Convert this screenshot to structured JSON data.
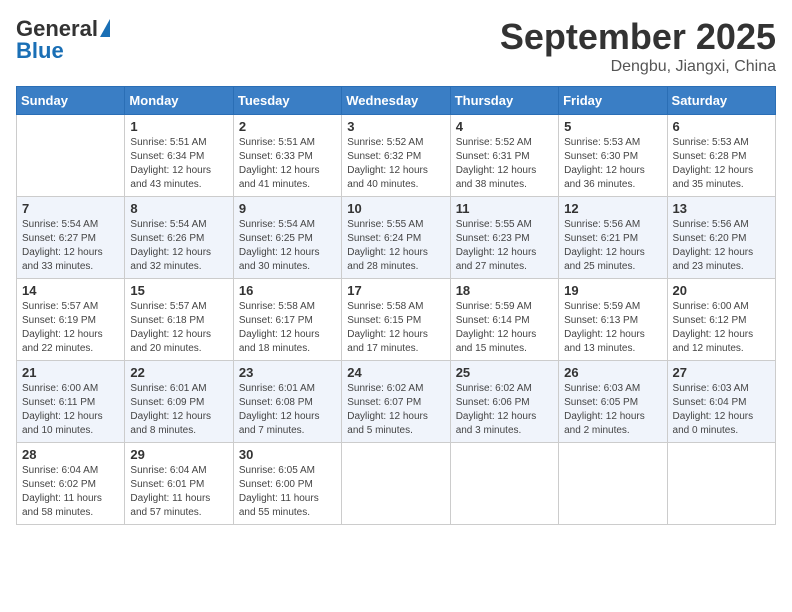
{
  "logo": {
    "general": "General",
    "blue": "Blue"
  },
  "header": {
    "month": "September 2025",
    "location": "Dengbu, Jiangxi, China"
  },
  "days_of_week": [
    "Sunday",
    "Monday",
    "Tuesday",
    "Wednesday",
    "Thursday",
    "Friday",
    "Saturday"
  ],
  "weeks": [
    [
      {
        "num": "",
        "info": ""
      },
      {
        "num": "1",
        "info": "Sunrise: 5:51 AM\nSunset: 6:34 PM\nDaylight: 12 hours\nand 43 minutes."
      },
      {
        "num": "2",
        "info": "Sunrise: 5:51 AM\nSunset: 6:33 PM\nDaylight: 12 hours\nand 41 minutes."
      },
      {
        "num": "3",
        "info": "Sunrise: 5:52 AM\nSunset: 6:32 PM\nDaylight: 12 hours\nand 40 minutes."
      },
      {
        "num": "4",
        "info": "Sunrise: 5:52 AM\nSunset: 6:31 PM\nDaylight: 12 hours\nand 38 minutes."
      },
      {
        "num": "5",
        "info": "Sunrise: 5:53 AM\nSunset: 6:30 PM\nDaylight: 12 hours\nand 36 minutes."
      },
      {
        "num": "6",
        "info": "Sunrise: 5:53 AM\nSunset: 6:28 PM\nDaylight: 12 hours\nand 35 minutes."
      }
    ],
    [
      {
        "num": "7",
        "info": "Sunrise: 5:54 AM\nSunset: 6:27 PM\nDaylight: 12 hours\nand 33 minutes."
      },
      {
        "num": "8",
        "info": "Sunrise: 5:54 AM\nSunset: 6:26 PM\nDaylight: 12 hours\nand 32 minutes."
      },
      {
        "num": "9",
        "info": "Sunrise: 5:54 AM\nSunset: 6:25 PM\nDaylight: 12 hours\nand 30 minutes."
      },
      {
        "num": "10",
        "info": "Sunrise: 5:55 AM\nSunset: 6:24 PM\nDaylight: 12 hours\nand 28 minutes."
      },
      {
        "num": "11",
        "info": "Sunrise: 5:55 AM\nSunset: 6:23 PM\nDaylight: 12 hours\nand 27 minutes."
      },
      {
        "num": "12",
        "info": "Sunrise: 5:56 AM\nSunset: 6:21 PM\nDaylight: 12 hours\nand 25 minutes."
      },
      {
        "num": "13",
        "info": "Sunrise: 5:56 AM\nSunset: 6:20 PM\nDaylight: 12 hours\nand 23 minutes."
      }
    ],
    [
      {
        "num": "14",
        "info": "Sunrise: 5:57 AM\nSunset: 6:19 PM\nDaylight: 12 hours\nand 22 minutes."
      },
      {
        "num": "15",
        "info": "Sunrise: 5:57 AM\nSunset: 6:18 PM\nDaylight: 12 hours\nand 20 minutes."
      },
      {
        "num": "16",
        "info": "Sunrise: 5:58 AM\nSunset: 6:17 PM\nDaylight: 12 hours\nand 18 minutes."
      },
      {
        "num": "17",
        "info": "Sunrise: 5:58 AM\nSunset: 6:15 PM\nDaylight: 12 hours\nand 17 minutes."
      },
      {
        "num": "18",
        "info": "Sunrise: 5:59 AM\nSunset: 6:14 PM\nDaylight: 12 hours\nand 15 minutes."
      },
      {
        "num": "19",
        "info": "Sunrise: 5:59 AM\nSunset: 6:13 PM\nDaylight: 12 hours\nand 13 minutes."
      },
      {
        "num": "20",
        "info": "Sunrise: 6:00 AM\nSunset: 6:12 PM\nDaylight: 12 hours\nand 12 minutes."
      }
    ],
    [
      {
        "num": "21",
        "info": "Sunrise: 6:00 AM\nSunset: 6:11 PM\nDaylight: 12 hours\nand 10 minutes."
      },
      {
        "num": "22",
        "info": "Sunrise: 6:01 AM\nSunset: 6:09 PM\nDaylight: 12 hours\nand 8 minutes."
      },
      {
        "num": "23",
        "info": "Sunrise: 6:01 AM\nSunset: 6:08 PM\nDaylight: 12 hours\nand 7 minutes."
      },
      {
        "num": "24",
        "info": "Sunrise: 6:02 AM\nSunset: 6:07 PM\nDaylight: 12 hours\nand 5 minutes."
      },
      {
        "num": "25",
        "info": "Sunrise: 6:02 AM\nSunset: 6:06 PM\nDaylight: 12 hours\nand 3 minutes."
      },
      {
        "num": "26",
        "info": "Sunrise: 6:03 AM\nSunset: 6:05 PM\nDaylight: 12 hours\nand 2 minutes."
      },
      {
        "num": "27",
        "info": "Sunrise: 6:03 AM\nSunset: 6:04 PM\nDaylight: 12 hours\nand 0 minutes."
      }
    ],
    [
      {
        "num": "28",
        "info": "Sunrise: 6:04 AM\nSunset: 6:02 PM\nDaylight: 11 hours\nand 58 minutes."
      },
      {
        "num": "29",
        "info": "Sunrise: 6:04 AM\nSunset: 6:01 PM\nDaylight: 11 hours\nand 57 minutes."
      },
      {
        "num": "30",
        "info": "Sunrise: 6:05 AM\nSunset: 6:00 PM\nDaylight: 11 hours\nand 55 minutes."
      },
      {
        "num": "",
        "info": ""
      },
      {
        "num": "",
        "info": ""
      },
      {
        "num": "",
        "info": ""
      },
      {
        "num": "",
        "info": ""
      }
    ]
  ]
}
